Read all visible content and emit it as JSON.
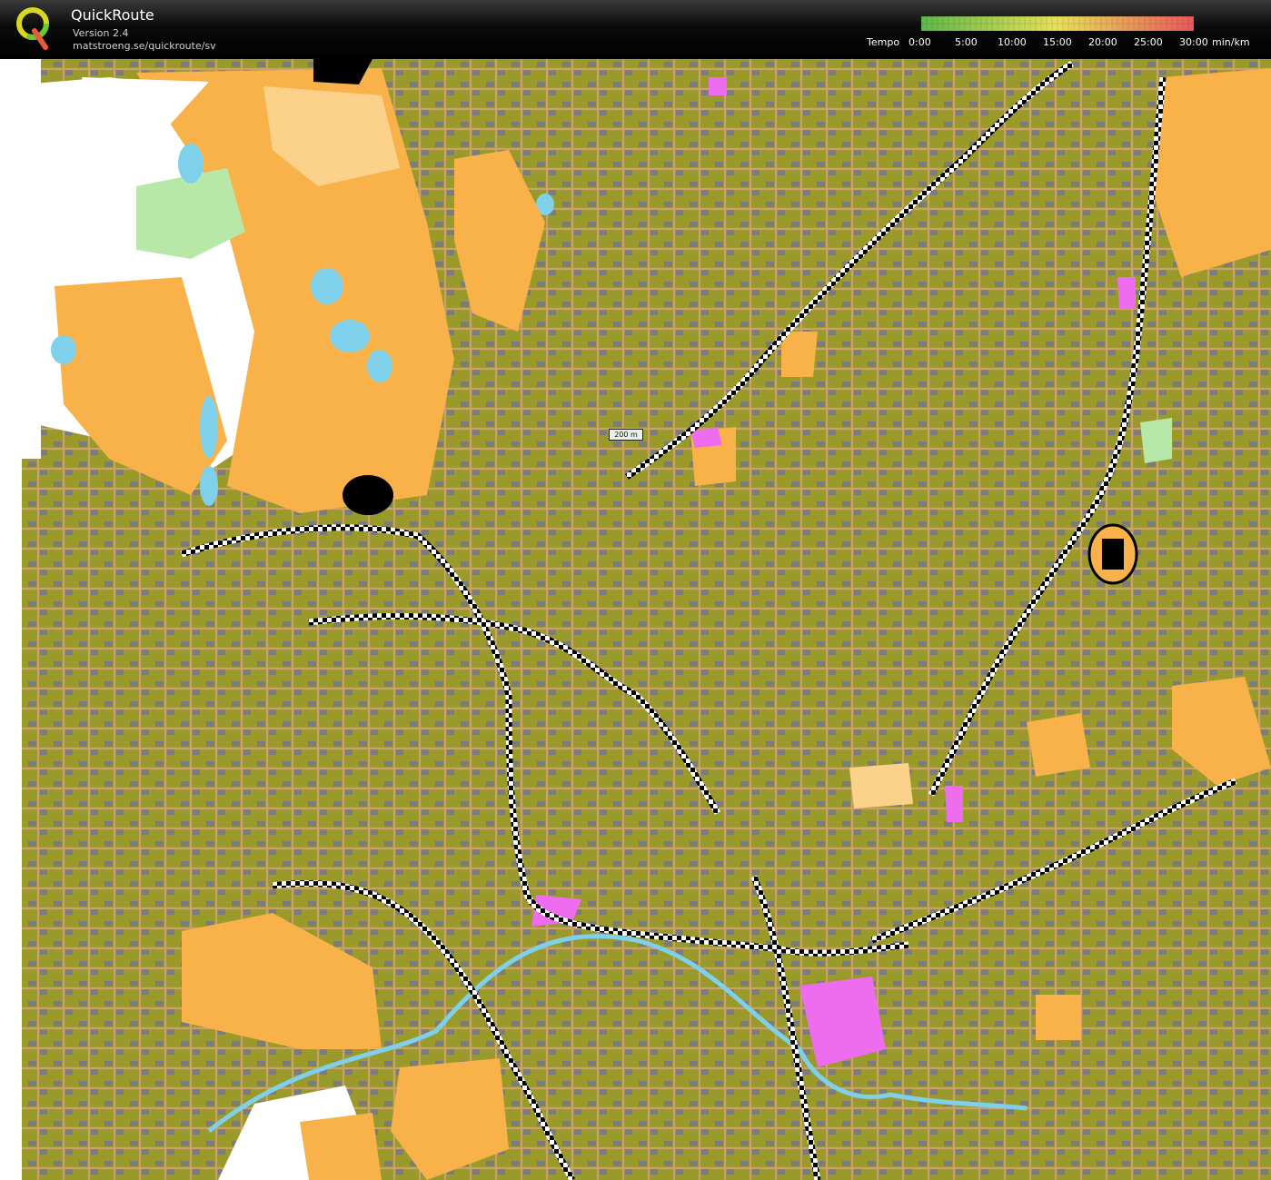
{
  "app": {
    "title": "QuickRoute",
    "version": "Version 2.4",
    "url": "matstroeng.se/quickroute/sv",
    "logo_letter": "Q"
  },
  "legend": {
    "label": "Tempo",
    "ticks": [
      "0:00",
      "5:00",
      "10:00",
      "15:00",
      "20:00",
      "25:00",
      "30:00"
    ],
    "unit": "min/km",
    "colors": {
      "start": "#5fb84a",
      "middle": "#e8e05a",
      "end": "#e85a5a"
    }
  },
  "map": {
    "scale_label": "200 m",
    "colors": {
      "urban": "#9a9a2a",
      "open": "#f9b24a",
      "rough_open": "#fcd28a",
      "building": "#7c7c7c",
      "paved": "#c9a06e",
      "water": "#7fd0ea",
      "forest": "#ffffff",
      "green": "#b8e8a8",
      "special": "#ee6cee"
    }
  }
}
